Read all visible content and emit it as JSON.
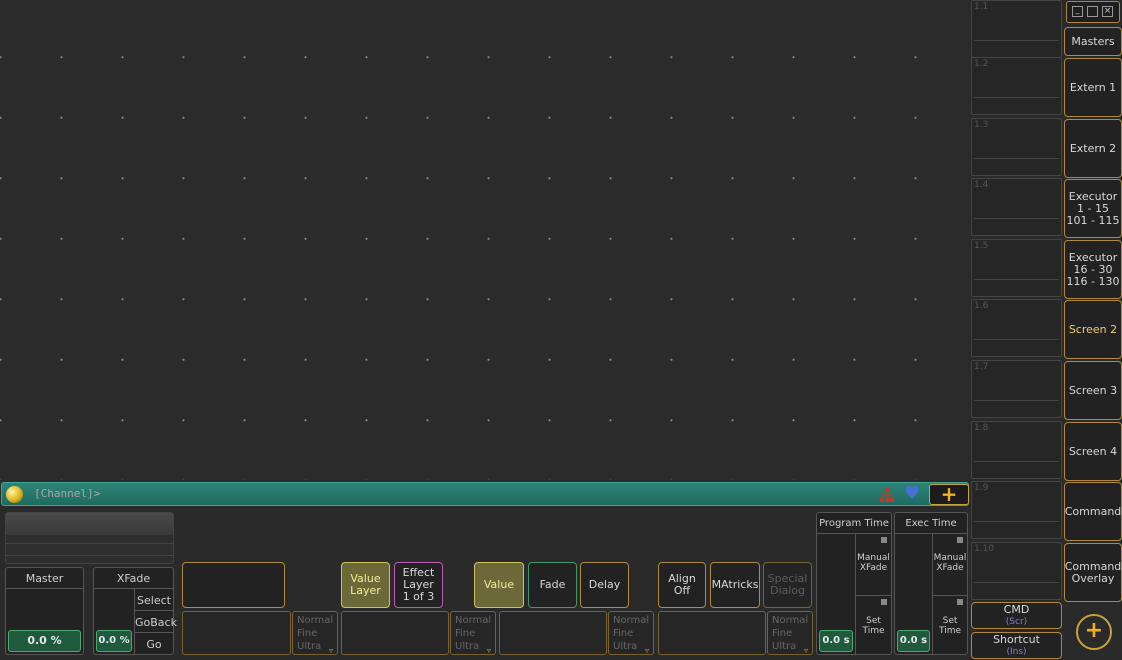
{
  "command_line": {
    "prompt": "[Channel]>"
  },
  "masters": {
    "master_label": "Master",
    "master_value": "0.0 %",
    "xfade_label": "XFade",
    "xfade_value": "0.0 %",
    "select": "Select",
    "goback": "GoBack",
    "go": "Go"
  },
  "layers": {
    "value_layer": "Value\nLayer",
    "effect_layer": "Effect\nLayer\n1 of 3",
    "value": "Value",
    "fade": "Fade",
    "delay": "Delay",
    "align": "Align\nOff",
    "matricks": "MAtricks",
    "special_dialog": "Special\nDialog",
    "resolution": "Normal\nFine\nUltra"
  },
  "timing": {
    "program_time_label": "Program Time",
    "program_time_value": "0.0 s",
    "exec_time_label": "Exec Time",
    "exec_time_value": "0.0 s",
    "manual_xfade": "Manual\nXFade",
    "set_time": "Set\nTime"
  },
  "view_slots": [
    "1.1",
    "1.2",
    "1.3",
    "1.4",
    "1.5",
    "1.6",
    "1.7",
    "1.8",
    "1.9",
    "1.10"
  ],
  "sidebar": {
    "masters": "Masters",
    "extern1": "Extern 1",
    "extern2": "Extern 2",
    "executor1": "Executor\n1 - 15\n101 - 115",
    "executor2": "Executor\n16 - 30\n116 - 130",
    "screen2": "Screen 2",
    "screen3": "Screen 3",
    "screen4": "Screen 4",
    "command": "Command",
    "command_overlay": "Command\nOverlay",
    "cmd": "CMD",
    "cmd_key": "(Scr)",
    "shortcut": "Shortcut",
    "shortcut_key": "(Ins)"
  },
  "colors": {
    "accent_gold": "#b08a3a",
    "active_yellow": "#d0c060",
    "command_line_teal": "#2e8478",
    "active_sidebar_text": "#f0d070"
  }
}
